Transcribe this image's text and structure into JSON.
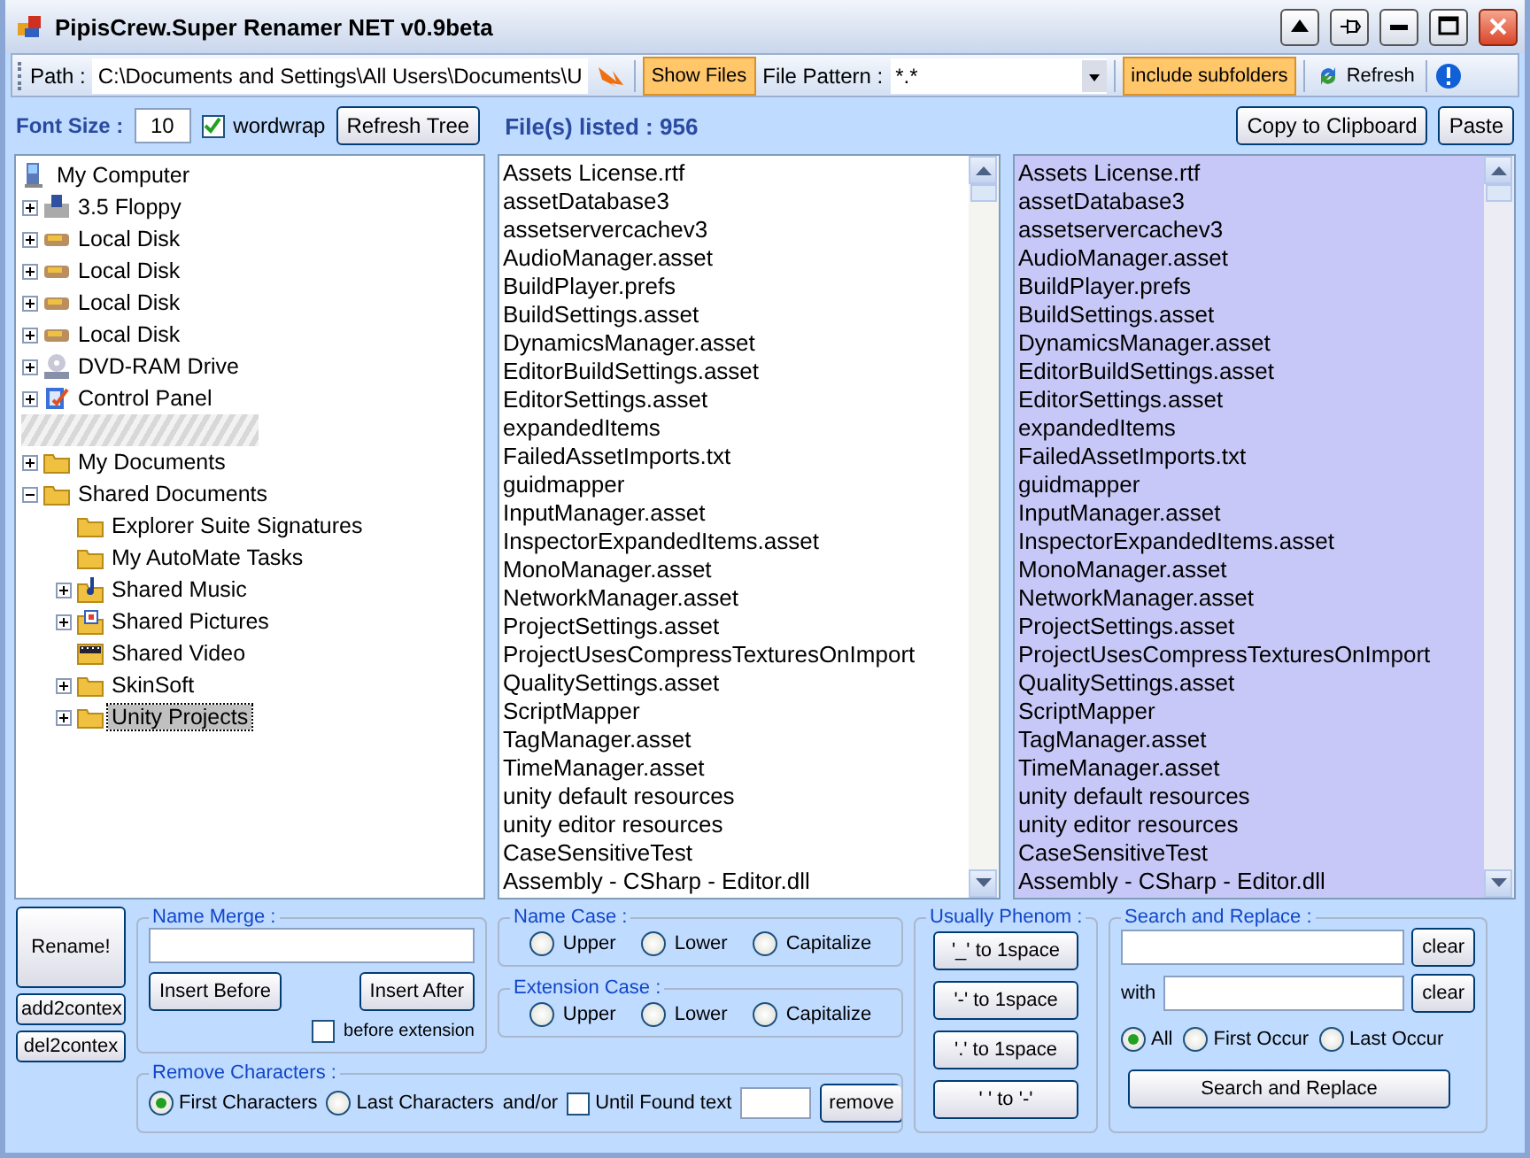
{
  "window": {
    "title": "PipisCrew.Super Renamer NET v0.9beta"
  },
  "toolbar": {
    "path_label": "Path :",
    "path_value": "C:\\Documents and Settings\\All Users\\Documents\\U",
    "show_files": "Show Files",
    "pattern_label": "File Pattern :",
    "pattern_value": "*.*",
    "include_subfolders": "include subfolders",
    "refresh": "Refresh"
  },
  "options": {
    "font_size_label": "Font Size :",
    "font_size_value": "10",
    "wordwrap": {
      "label": "wordwrap",
      "checked": true
    },
    "refresh_tree": "Refresh Tree",
    "files_listed": "File(s) listed : 956",
    "copy": "Copy to Clipboard",
    "paste": "Paste"
  },
  "tree": [
    {
      "kind": "computer",
      "label": "My Computer",
      "selected": false,
      "children": [
        {
          "kind": "floppy",
          "label": "3.5 Floppy",
          "expanded": false,
          "selected": false
        },
        {
          "kind": "disk",
          "label": "Local Disk",
          "expanded": false,
          "selected": false
        },
        {
          "kind": "disk",
          "label": "Local Disk",
          "expanded": false,
          "selected": false
        },
        {
          "kind": "disk",
          "label": "Local Disk",
          "expanded": false,
          "selected": false
        },
        {
          "kind": "disk",
          "label": "Local Disk",
          "expanded": false,
          "selected": false
        },
        {
          "kind": "dvd",
          "label": "DVD-RAM Drive",
          "expanded": false,
          "selected": false
        },
        {
          "kind": "control",
          "label": "Control Panel",
          "expanded": false,
          "selected": false
        },
        {
          "kind": "obscured"
        },
        {
          "kind": "folder",
          "label": "My Documents",
          "expanded": false,
          "selected": false
        },
        {
          "kind": "folder",
          "label": "Shared Documents",
          "expanded": true,
          "selected": false,
          "children": [
            {
              "kind": "folder",
              "label": "Explorer Suite Signatures",
              "selected": false
            },
            {
              "kind": "folder",
              "label": "My AutoMate Tasks",
              "selected": false
            },
            {
              "kind": "music",
              "label": "Shared Music",
              "expanded": false,
              "selected": false
            },
            {
              "kind": "pictures",
              "label": "Shared Pictures",
              "expanded": false,
              "selected": false
            },
            {
              "kind": "video",
              "label": "Shared Video",
              "selected": false
            },
            {
              "kind": "folder",
              "label": "SkinSoft",
              "expanded": false,
              "selected": false
            },
            {
              "kind": "folder",
              "label": "Unity Projects",
              "expanded": false,
              "selected": true
            }
          ]
        }
      ]
    }
  ],
  "files": [
    "Assets License.rtf",
    "assetDatabase3",
    "assetservercachev3",
    "AudioManager.asset",
    "BuildPlayer.prefs",
    "BuildSettings.asset",
    "DynamicsManager.asset",
    "EditorBuildSettings.asset",
    "EditorSettings.asset",
    "expandedItems",
    "FailedAssetImports.txt",
    "guidmapper",
    "InputManager.asset",
    "InspectorExpandedItems.asset",
    "MonoManager.asset",
    "NetworkManager.asset",
    "ProjectSettings.asset",
    "ProjectUsesCompressTexturesOnImport",
    "QualitySettings.asset",
    "ScriptMapper",
    "TagManager.asset",
    "TimeManager.asset",
    "unity default resources",
    "unity editor resources",
    "CaseSensitiveTest",
    "Assembly - CSharp - Editor.dll"
  ],
  "preview": [
    "Assets License.rtf",
    "assetDatabase3",
    "assetservercachev3",
    "AudioManager.asset",
    "BuildPlayer.prefs",
    "BuildSettings.asset",
    "DynamicsManager.asset",
    "EditorBuildSettings.asset",
    "EditorSettings.asset",
    "expandedItems",
    "FailedAssetImports.txt",
    "guidmapper",
    "InputManager.asset",
    "InspectorExpandedItems.asset",
    "MonoManager.asset",
    "NetworkManager.asset",
    "ProjectSettings.asset",
    "ProjectUsesCompressTexturesOnImport",
    "QualitySettings.asset",
    "ScriptMapper",
    "TagManager.asset",
    "TimeManager.asset",
    "unity default resources",
    "unity editor resources",
    "CaseSensitiveTest",
    "Assembly - CSharp - Editor.dll"
  ],
  "actions": {
    "rename": "Rename!",
    "add_context": "add2contex",
    "del_context": "del2contex"
  },
  "name_merge": {
    "title": "Name Merge :",
    "insert_before": "Insert Before",
    "insert_after": "Insert After",
    "before_extension": {
      "label": "before extension",
      "checked": false
    }
  },
  "name_case": {
    "title": "Name Case :",
    "options": [
      {
        "label": "Upper",
        "selected": false
      },
      {
        "label": "Lower",
        "selected": false
      },
      {
        "label": "Capitalize",
        "selected": false
      }
    ]
  },
  "extension_case": {
    "title": "Extension Case :",
    "options": [
      {
        "label": "Upper",
        "selected": false
      },
      {
        "label": "Lower",
        "selected": false
      },
      {
        "label": "Capitalize",
        "selected": false
      }
    ]
  },
  "remove_characters": {
    "title": "Remove Characters :",
    "options": [
      {
        "label": "First Characters",
        "selected": true
      },
      {
        "label": "Last Characters",
        "selected": false
      }
    ],
    "andor": "and/or",
    "until_found": {
      "label": "Until Found text",
      "checked": false
    },
    "remove": "remove"
  },
  "usually_phenom": {
    "title": "Usually Phenom :",
    "buttons": [
      "'_' to 1space",
      "'-' to 1space",
      "'.' to 1space",
      "' ' to '-'"
    ]
  },
  "search_replace": {
    "title": "Search and Replace :",
    "clear_1": "clear",
    "with_label": "with",
    "clear_2": "clear",
    "scope": [
      {
        "label": "All",
        "selected": true
      },
      {
        "label": "First Occur",
        "selected": false
      },
      {
        "label": "Last Occur",
        "selected": false
      }
    ],
    "button": "Search and Replace"
  }
}
